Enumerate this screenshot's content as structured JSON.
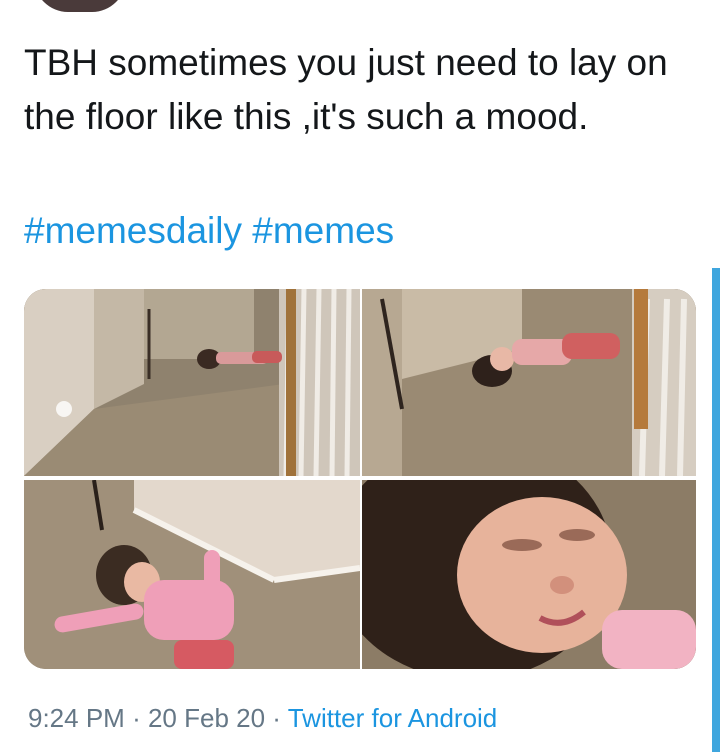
{
  "tweet": {
    "text": "TBH sometimes you just need to lay on the floor like this ,it's such a mood.",
    "hashtags": [
      "#memesdaily",
      "#memes"
    ],
    "time": "9:24 PM",
    "date": "20 Feb 20",
    "separator": "·",
    "source": "Twitter for Android"
  },
  "photos": [
    {
      "icon": "photo-toddler-on-floor-far"
    },
    {
      "icon": "photo-toddler-on-floor-near-railing"
    },
    {
      "icon": "photo-toddler-on-floor-overhead"
    },
    {
      "icon": "photo-toddler-face-closeup"
    }
  ],
  "colors": {
    "text": "#14171a",
    "link": "#1b95e0",
    "meta": "#657786",
    "scroll_indicator": "#3fa6de"
  }
}
